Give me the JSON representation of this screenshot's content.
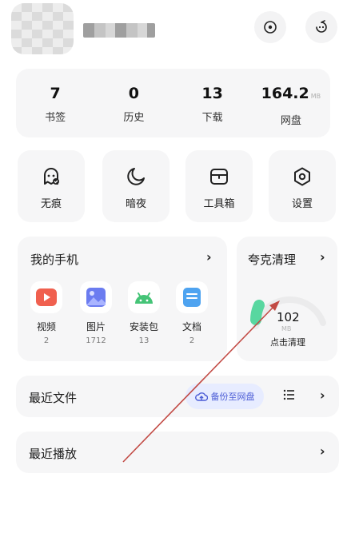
{
  "header": {
    "eye_icon": "eye-icon",
    "face_icon": "face-icon"
  },
  "stats": [
    {
      "value": "7",
      "unit": "",
      "label": "书签"
    },
    {
      "value": "0",
      "unit": "",
      "label": "历史"
    },
    {
      "value": "13",
      "unit": "",
      "label": "下载"
    },
    {
      "value": "164.2",
      "unit": "MB",
      "label": "网盘"
    }
  ],
  "tools": [
    {
      "label": "无痕",
      "icon": "ghost-icon"
    },
    {
      "label": "暗夜",
      "icon": "moon-icon"
    },
    {
      "label": "工具箱",
      "icon": "toolbox-icon"
    },
    {
      "label": "设置",
      "icon": "settings-hexagon-icon"
    }
  ],
  "my_phone": {
    "title": "我的手机",
    "chevron": "›",
    "apps": [
      {
        "label": "视频",
        "count": "2",
        "color": "#f0604f"
      },
      {
        "label": "图片",
        "count": "1712",
        "color": "#6b7cf0"
      },
      {
        "label": "安装包",
        "count": "13",
        "color": "#45c477"
      },
      {
        "label": "文档",
        "count": "2",
        "color": "#4ea3f0"
      }
    ]
  },
  "cleaner": {
    "title": "夸克清理",
    "chevron": "›",
    "value": "102",
    "unit": "MB",
    "action": "点击清理",
    "gauge_color": "#58d7a0"
  },
  "recent_files": {
    "title": "最近文件",
    "backup_label": "备份至网盘",
    "chevron": "›"
  },
  "recent_play": {
    "title": "最近播放",
    "chevron": "›"
  },
  "colors": {
    "arrow": "#c24a44",
    "card_bg": "#f6f6f7"
  }
}
